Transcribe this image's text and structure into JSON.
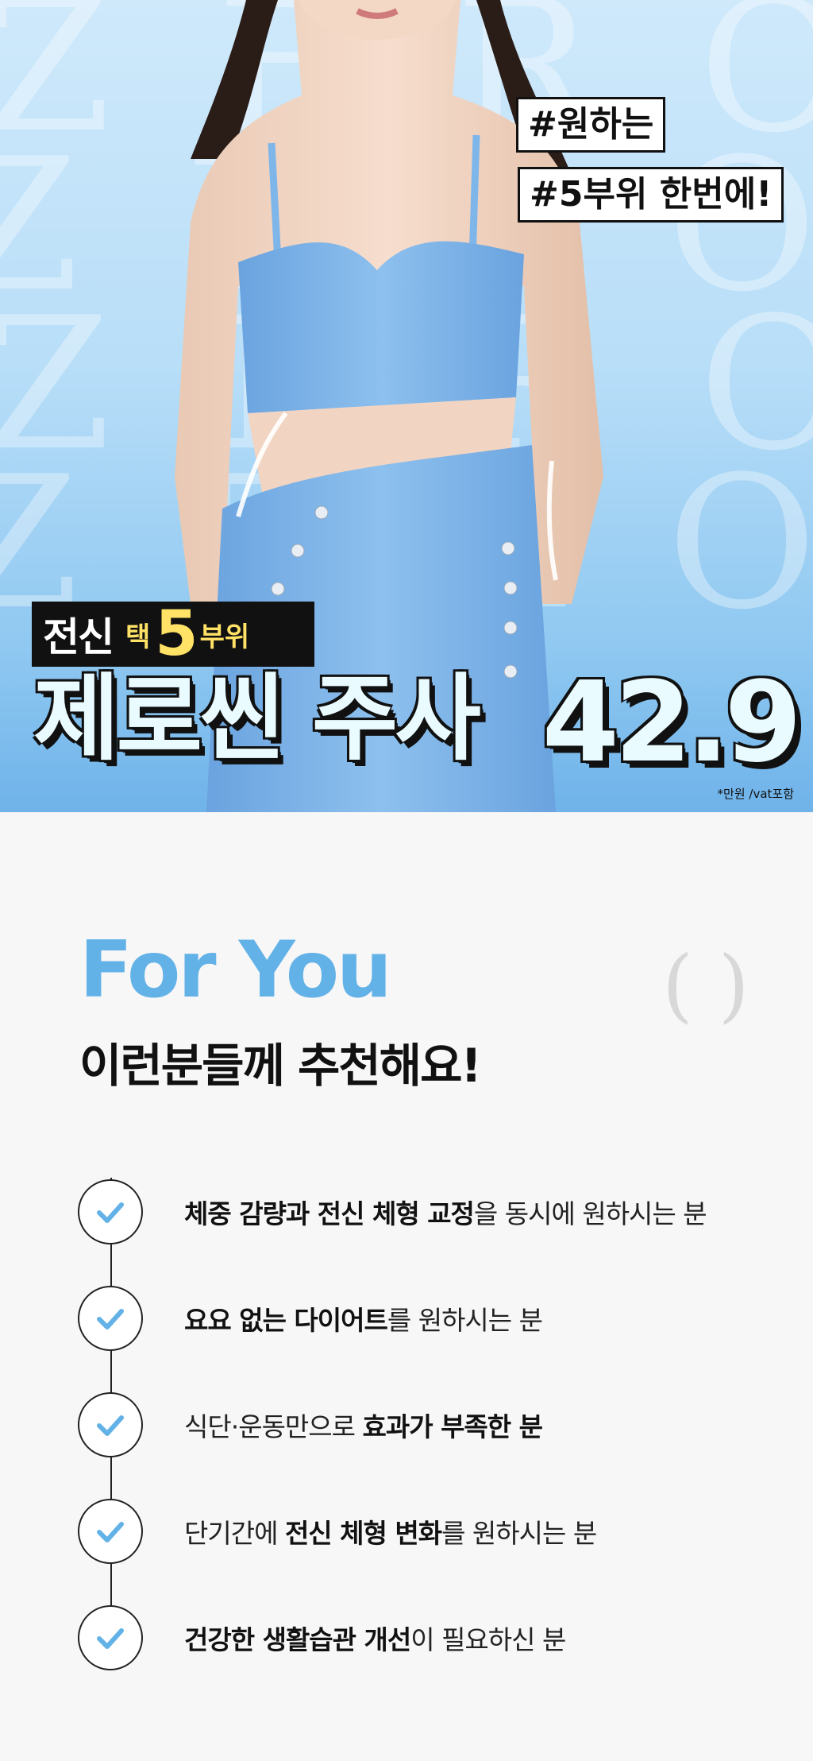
{
  "hero": {
    "watermark_text": "ZERO ZERO",
    "tags": [
      "#원하는",
      "#5부위 한번에!"
    ],
    "badge": {
      "word": "전신",
      "take": "택",
      "number": "5",
      "part": "부위"
    },
    "product_title": "제로씬 주사",
    "price": "42.9",
    "price_note": "*만원 /vat포함"
  },
  "section": {
    "heading": "For You",
    "subtitle": "이런분들께 추천해요!",
    "items": [
      {
        "segments": [
          [
            "b",
            "체중 감량과 전신 체형 교정"
          ],
          [
            "n",
            "을 동시에 원하시는 분"
          ]
        ]
      },
      {
        "segments": [
          [
            "b",
            "요요 없는 다이어트"
          ],
          [
            "n",
            "를 원하시는 분"
          ]
        ]
      },
      {
        "segments": [
          [
            "n",
            "식단·운동만으로 "
          ],
          [
            "b",
            "효과가 부족한 분"
          ]
        ]
      },
      {
        "segments": [
          [
            "n",
            "단기간에 "
          ],
          [
            "b",
            "전신 체형 변화"
          ],
          [
            "n",
            "를 원하시는 분"
          ]
        ]
      },
      {
        "segments": [
          [
            "b",
            "건강한 생활습관 개선"
          ],
          [
            "n",
            "이 필요하신 분"
          ]
        ]
      }
    ]
  },
  "colors": {
    "accent": "#63b2e7",
    "check": "#63b2e7",
    "outfit": "#7fb6ea"
  }
}
